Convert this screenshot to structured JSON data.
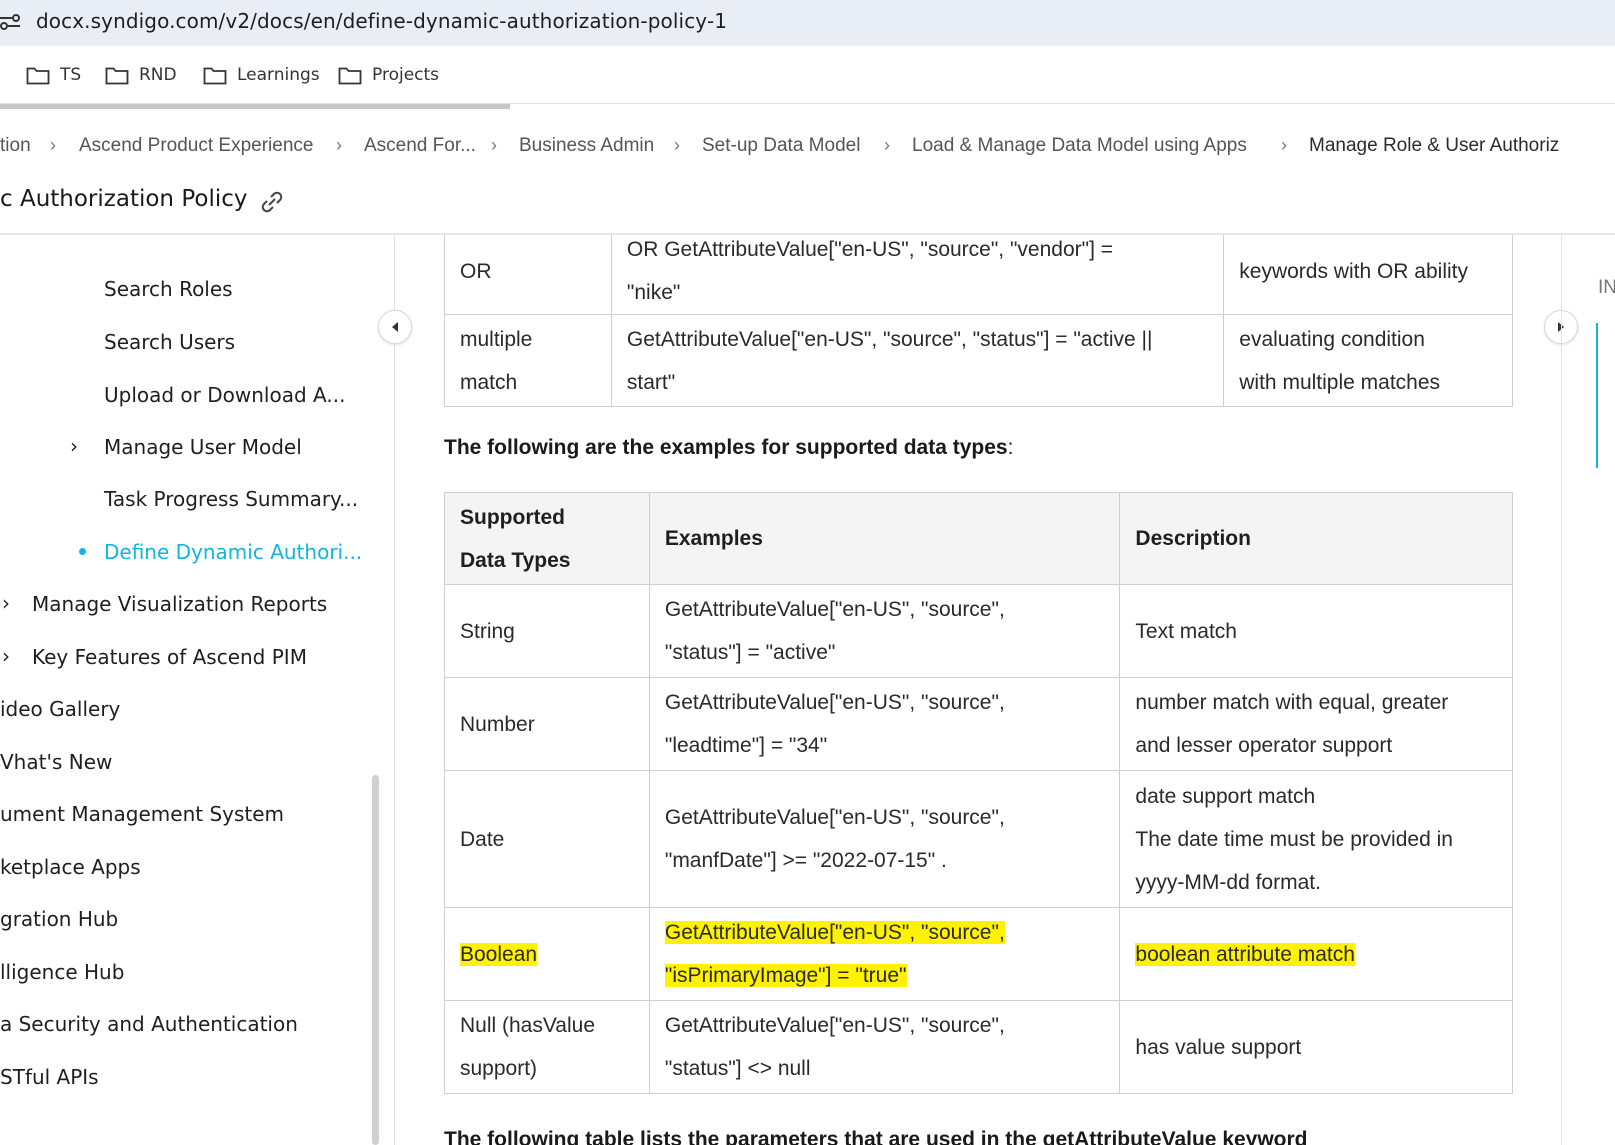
{
  "browser": {
    "url": "docx.syndigo.com/v2/docs/en/define-dynamic-authorization-policy-1",
    "bookmarks": [
      "TS",
      "RND",
      "Learnings",
      "Projects"
    ]
  },
  "breadcrumb": [
    "tion",
    "Ascend Product Experience",
    "Ascend For...",
    "Business Admin",
    "Set-up Data Model",
    "Load & Manage Data Model using Apps",
    "Manage Role & User Authoriz"
  ],
  "page_title": "c Authorization Policy",
  "sidebar": {
    "items": [
      {
        "label": "Search Roles"
      },
      {
        "label": "Search Users"
      },
      {
        "label": "Upload or Download A..."
      },
      {
        "label": "Manage User Model"
      },
      {
        "label": "Task Progress Summary..."
      },
      {
        "label": "Define Dynamic Authori..."
      },
      {
        "label": "Manage Visualization Reports"
      },
      {
        "label": "Key Features of Ascend PIM"
      },
      {
        "label": "ideo Gallery"
      },
      {
        "label": "Vhat's New"
      },
      {
        "label": "ument Management System"
      },
      {
        "label": "ketplace Apps"
      },
      {
        "label": "gration Hub"
      },
      {
        "label": "lligence Hub"
      },
      {
        "label": "a Security and Authentication"
      },
      {
        "label": "STful APIs"
      }
    ]
  },
  "keywords_table": {
    "rows": [
      {
        "keyword": "OR",
        "example": [
          "OR GetAttributeValue[\"en-US\", \"source\", \"vendor\"] =",
          "\"nike\""
        ],
        "description": [
          "keywords with OR ability"
        ]
      },
      {
        "keyword": [
          "multiple",
          "match"
        ],
        "example": [
          "GetAttributeValue[\"en-US\", \"source\", \"status\"] = \"active ||",
          "start\""
        ],
        "description": [
          "evaluating condition",
          "with multiple matches"
        ]
      }
    ]
  },
  "heading_datatypes": "The following are the examples for supported data types",
  "heading_datatypes_suffix": ":",
  "datatypes_table": {
    "headers": [
      [
        "Supported",
        "Data Types"
      ],
      "Examples",
      "Description"
    ],
    "rows": [
      {
        "type": "String",
        "example": [
          "GetAttributeValue[\"en-US\", \"source\",",
          "\"status\"] = \"active\""
        ],
        "description": [
          "Text match"
        ]
      },
      {
        "type": "Number",
        "example": [
          "GetAttributeValue[\"en-US\", \"source\",",
          "\"leadtime\"] = \"34\""
        ],
        "description": [
          "number match with equal, greater",
          "and lesser operator support"
        ]
      },
      {
        "type": "Date",
        "example": [
          "GetAttributeValue[\"en-US\", \"source\",",
          "\"manfDate\"] >= \"2022-07-15\" ."
        ],
        "description": [
          "date support match",
          "The date time must be provided in",
          "yyyy-MM-dd format."
        ]
      },
      {
        "type": "Boolean",
        "example": [
          "GetAttributeValue[\"en-US\", \"source\",",
          "\"isPrimaryImage\"] = \"true\""
        ],
        "description": [
          "boolean attribute match"
        ]
      },
      {
        "type": [
          "Null (hasValue",
          "support)"
        ],
        "example": [
          "GetAttributeValue[\"en-US\", \"source\",",
          "\"status\"] <> null"
        ],
        "description": [
          "has value support"
        ]
      }
    ]
  },
  "heading_parameters": "The following table lists the parameters that are used in the getAttributeValue keyword",
  "right_rail": {
    "label": "IN"
  },
  "colors": {
    "accent": "#10b5e0",
    "highlight": "#fff200"
  },
  "icons": [
    "site-settings-icon",
    "folder-icon",
    "link-icon",
    "chevron-right-icon",
    "caret-left-icon",
    "caret-right-icon"
  ]
}
